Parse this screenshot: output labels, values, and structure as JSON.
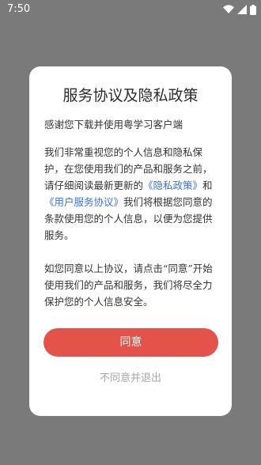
{
  "status_bar": {
    "time": "7:50",
    "icons": [
      "wifi-icon",
      "cellular-signal-icon",
      "battery-icon"
    ]
  },
  "dialog": {
    "title": "服务协议及隐私政策",
    "thanks": "感谢您下载并使用粤学习客户端",
    "main_text_1": "我们非常重视您的个人信息和隐私保护，在您使用我们的产品和服务之前，请仔细阅读最新更新的",
    "privacy_link": "《隐私政策》",
    "and": "和",
    "service_link": "《用户服务协议》",
    "main_text_2": "我们将根据您同意的条款使用您的个人信息，以便为您提供服务。",
    "consent_text": "如您同意以上协议，请点击“同意”开始使用我们的产品和服务，我们将尽全力保护您的个人信息安全。",
    "agree_label": "同意",
    "disagree_label": "不同意并退出"
  },
  "colors": {
    "accent": "#e4534a",
    "link": "#3a72d8",
    "overlay": "#7a7a7a"
  }
}
